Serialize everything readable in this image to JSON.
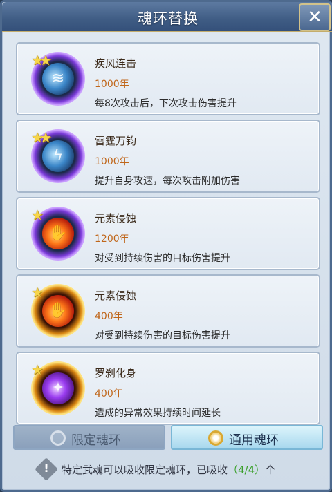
{
  "title": "魂环替换",
  "close_label": "✕",
  "rings": [
    {
      "name": "疾风连击",
      "years": "1000年",
      "desc": "每8次攻击后，下次攻击伤害提升",
      "stars": 2,
      "icon": "wind-slash-icon",
      "ring_color": "#a56cf0"
    },
    {
      "name": "雷霆万钧",
      "years": "1000年",
      "desc": "提升自身攻速，每次攻击附加伤害",
      "stars": 2,
      "icon": "lightning-figure-icon",
      "ring_color": "#a56cf0"
    },
    {
      "name": "元素侵蚀",
      "years": "1200年",
      "desc": "对受到持续伤害的目标伤害提升",
      "stars": 1,
      "icon": "fire-hands-icon",
      "ring_color": "#a56cf0"
    },
    {
      "name": "元素侵蚀",
      "years": "400年",
      "desc": "对受到持续伤害的目标伤害提升",
      "stars": 1,
      "icon": "fire-hands-icon",
      "ring_color": "#e8a820"
    },
    {
      "name": "罗刹化身",
      "years": "400年",
      "desc": "造成的异常效果持续时间延长",
      "stars": 1,
      "icon": "purple-crystal-icon",
      "ring_color": "#e8a820"
    }
  ],
  "tabs": {
    "limited": "限定魂环",
    "general": "通用魂环",
    "selected": "general"
  },
  "notice": {
    "text": "特定武魂可以吸收限定魂环，已吸收",
    "count": "（4/4）",
    "suffix": "个"
  },
  "colors": {
    "accent_year": "#c0661a",
    "count_green": "#3aa02a"
  }
}
